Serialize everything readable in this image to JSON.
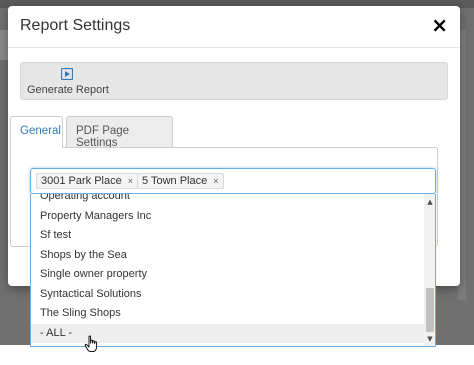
{
  "modal": {
    "title": "Report Settings",
    "close_glyph": "×"
  },
  "toolbar": {
    "generate_label": "Generate Report",
    "generate_icon": "play-icon"
  },
  "tabs": [
    {
      "label": "General",
      "active": true
    },
    {
      "label": "PDF Page Settings",
      "active": false
    }
  ],
  "multiselect": {
    "chips": [
      {
        "label": "3001 Park Place",
        "remove": "×"
      },
      {
        "label": "5 Town Place",
        "remove": "×"
      }
    ]
  },
  "dropdown": {
    "options": [
      "Operating account",
      "Property Managers Inc",
      "Sf test",
      "Shops by the Sea",
      "Single owner property",
      "Syntactical Solutions",
      "The Sling Shops",
      "- ALL -"
    ],
    "hovered_option": "- ALL -",
    "scroll_up_glyph": "▲",
    "scroll_down_glyph": "▼"
  },
  "colors": {
    "accent": "#337ab7",
    "focus_border": "#66afe9",
    "toolbar_bg": "#e6e6e6",
    "hover_bg": "#eeeeee"
  }
}
